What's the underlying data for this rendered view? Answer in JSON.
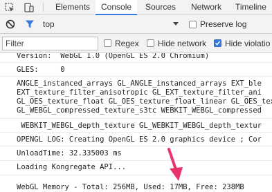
{
  "tabs": [
    {
      "label": "Elements"
    },
    {
      "label": "Console"
    },
    {
      "label": "Sources"
    },
    {
      "label": "Network"
    },
    {
      "label": "Timeline"
    }
  ],
  "toolbar": {
    "context": "top",
    "preserve_log_label": "Preserve log",
    "filter_placeholder": "Filter",
    "regex_label": "Regex",
    "hide_network_label": "Hide network",
    "hide_violations_label": "Hide violatio"
  },
  "console": {
    "lines": [
      "Version:  WebGL 1.0 (OpenGL ES 2.0 Chromium)",
      "GLES:     0",
      "ANGLE_instanced_arrays GL_ANGLE_instanced_arrays EXT_ble",
      "EXT_texture_filter_anisotropic GL_EXT_texture_filter_ani",
      "GL_OES_texture_float GL_OES_texture_float_linear GL_OES_tex",
      "GL_WEBGL_compressed_texture_s3tc WEBKIT_WEBGL_compressed",
      " WEBKIT_WEBGL_depth_texture GL_WEBKIT_WEBGL_depth_textur",
      "OPENGL LOG: Creating OpenGL ES 2.0 graphics device ; Cor",
      "UnloadTime: 32.335003 ms",
      "Loading Kongregate API...",
      "WebGL Memory - Total: 256MB, Used: 17MB, Free: 238MB"
    ]
  },
  "colors": {
    "accent": "#3879d9",
    "annotation_arrow": "#e8336b"
  }
}
